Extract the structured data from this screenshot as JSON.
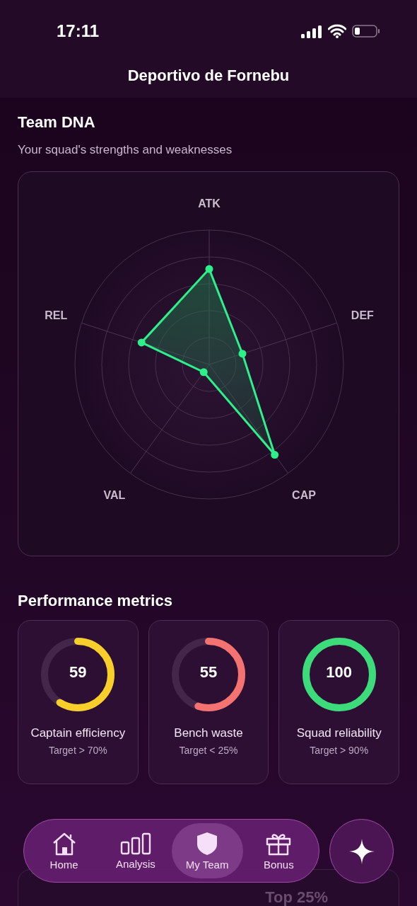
{
  "status_bar": {
    "time": "17:11"
  },
  "header": {
    "title": "Deportivo de Fornebu"
  },
  "team_dna": {
    "title": "Team DNA",
    "subtitle": "Your squad's strengths and weaknesses",
    "axes": [
      "ATK",
      "DEF",
      "CAP",
      "VAL",
      "REL"
    ]
  },
  "performance": {
    "title": "Performance metrics",
    "metrics": [
      {
        "value": "59",
        "label": "Captain efficiency",
        "target": "Target > 70%",
        "level": 0.59,
        "color": "#f8cf2a"
      },
      {
        "value": "55",
        "label": "Bench waste",
        "target": "Target < 25%",
        "level": 0.55,
        "color": "#f4726f"
      },
      {
        "value": "100",
        "label": "Squad reliability",
        "target": "Target > 90%",
        "level": 1,
        "color": "#3ddc7a"
      }
    ]
  },
  "next_card": {
    "badge": "Top 25%"
  },
  "nav": {
    "items": [
      {
        "kind": "home",
        "label": "Home",
        "selected": false
      },
      {
        "kind": "analysis",
        "label": "Analysis",
        "selected": false
      },
      {
        "kind": "team",
        "label": "My Team",
        "selected": true
      },
      {
        "kind": "bonus",
        "label": "Bonus",
        "selected": false
      }
    ]
  }
}
